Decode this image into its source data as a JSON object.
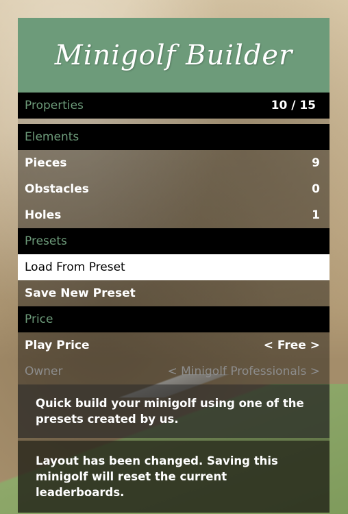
{
  "menu": {
    "title": "Minigolf Builder",
    "subheader": {
      "label": "Properties",
      "count": "10 / 15"
    },
    "items": [
      {
        "label": "Elements",
        "type": "section"
      },
      {
        "label": "Pieces",
        "value": "9",
        "type": "item"
      },
      {
        "label": "Obstacles",
        "value": "0",
        "type": "item"
      },
      {
        "label": "Holes",
        "value": "1",
        "type": "item"
      },
      {
        "label": "Presets",
        "type": "section"
      },
      {
        "label": "Load From Preset",
        "type": "selected"
      },
      {
        "label": "Save New Preset",
        "type": "item"
      },
      {
        "label": "Price",
        "type": "section"
      },
      {
        "label": "Play Price",
        "value": "< Free >",
        "type": "item"
      },
      {
        "label": "Owner",
        "value": "< Minigolf Professionals >",
        "type": "disabled"
      }
    ],
    "description": "Quick build your minigolf using one of the presets created by us.",
    "warning": "Layout has been changed. Saving this minigolf will reset the current leaderboards."
  },
  "colors": {
    "accent": "#6d9b7a",
    "section_bg": "#000000",
    "selected_bg": "#ffffff"
  }
}
